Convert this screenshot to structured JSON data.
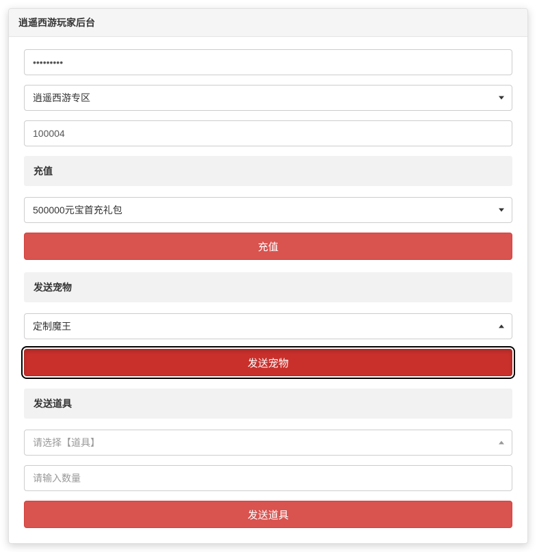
{
  "header": {
    "title": "逍遥西游玩家后台"
  },
  "password": {
    "value": "•••••••••"
  },
  "zone_select": {
    "selected": "逍遥西游专区"
  },
  "player_id": {
    "value": "100004"
  },
  "recharge": {
    "header": "充值",
    "select": {
      "selected": "500000元宝首充礼包"
    },
    "button": "充值"
  },
  "send_pet": {
    "header": "发送宠物",
    "select": {
      "selected": "定制魔王"
    },
    "button": "发送宠物"
  },
  "send_item": {
    "header": "发送道具",
    "select": {
      "placeholder": "请选择【道具】"
    },
    "quantity_placeholder": "请输入数量",
    "button": "发送道具"
  }
}
